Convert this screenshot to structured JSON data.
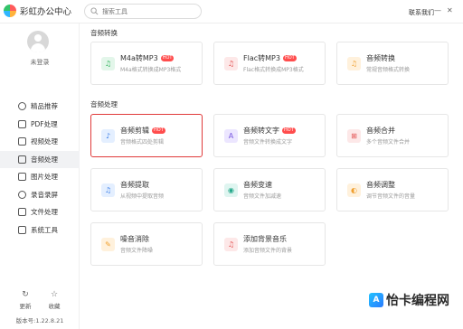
{
  "app": {
    "title": "彩虹办公中心"
  },
  "search": {
    "placeholder": "搜索工具"
  },
  "header": {
    "contact": "联系我们",
    "minimize_glyph": "—",
    "close_glyph": "✕"
  },
  "user": {
    "login_label": "未登录"
  },
  "sidebar": {
    "items": [
      {
        "label": "精品推荐",
        "icon": "thumb-icon"
      },
      {
        "label": "PDF处理",
        "icon": "pdf-icon"
      },
      {
        "label": "视频处理",
        "icon": "video-icon"
      },
      {
        "label": "音频处理",
        "icon": "music-icon",
        "active": true
      },
      {
        "label": "图片处理",
        "icon": "image-icon"
      },
      {
        "label": "录音录屏",
        "icon": "record-icon"
      },
      {
        "label": "文件处理",
        "icon": "folder-icon"
      },
      {
        "label": "系统工具",
        "icon": "tools-icon"
      }
    ],
    "update_label": "更新",
    "favorite_label": "收藏",
    "version": "版本号:1.22.8.21"
  },
  "sections": [
    {
      "title": "音频转换",
      "cards": [
        {
          "title": "M4a转MP3",
          "desc": "M4a格式转换成MP3格式",
          "hot": "HOT",
          "icon": "m4a-icon",
          "icon_glyph": "♫"
        },
        {
          "title": "Flac转MP3",
          "desc": "Flac格式转换成MP3格式",
          "hot": "HOT",
          "icon": "flac-icon",
          "icon_glyph": "♫"
        },
        {
          "title": "音频转换",
          "desc": "常规音频格式转换",
          "hot": "",
          "icon": "audio-convert-icon",
          "icon_glyph": "♫"
        }
      ]
    },
    {
      "title": "音频处理",
      "cards": [
        {
          "title": "音频剪辑",
          "desc": "音频格式四处剪辑",
          "hot": "HOT",
          "icon": "audio-cut-icon",
          "icon_glyph": "♪",
          "selected": true
        },
        {
          "title": "音频转文字",
          "desc": "音频文件转换成文字",
          "hot": "HOT",
          "icon": "audio-to-text-icon",
          "icon_glyph": "A"
        },
        {
          "title": "音频合并",
          "desc": "多个音频文件合并",
          "hot": "",
          "icon": "audio-merge-icon",
          "icon_glyph": "⊞"
        },
        {
          "title": "音频提取",
          "desc": "从视频中提取音频",
          "hot": "",
          "icon": "audio-extract-icon",
          "icon_glyph": "♫"
        },
        {
          "title": "音频变速",
          "desc": "音频文件加减速",
          "hot": "",
          "icon": "audio-speed-icon",
          "icon_glyph": "◉"
        },
        {
          "title": "音频调整",
          "desc": "调节音频文件的音量",
          "hot": "",
          "icon": "audio-volume-icon",
          "icon_glyph": "◐"
        },
        {
          "title": "噪音消除",
          "desc": "音频文件降噪",
          "hot": "",
          "icon": "noise-remove-icon",
          "icon_glyph": "✎"
        },
        {
          "title": "添加背景音乐",
          "desc": "添加音频文件的背景",
          "hot": "",
          "icon": "bg-music-icon",
          "icon_glyph": "♫"
        }
      ]
    }
  ],
  "watermark": {
    "text": "怡卡编程网",
    "logo_glyph": "A"
  },
  "colors": {
    "selected_border": "#e03a3a",
    "hot_badge": "#ff4d4d"
  }
}
